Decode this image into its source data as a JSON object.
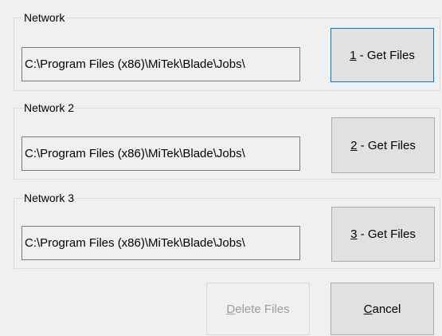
{
  "groups": [
    {
      "label": "Network",
      "path": "C:\\Program Files (x86)\\MiTek\\Blade\\Jobs\\",
      "button_mnemonic": "1",
      "button_rest": " - Get Files"
    },
    {
      "label": "Network 2",
      "path": "C:\\Program Files (x86)\\MiTek\\Blade\\Jobs\\",
      "button_mnemonic": "2",
      "button_rest": " - Get Files"
    },
    {
      "label": "Network 3",
      "path": "C:\\Program Files (x86)\\MiTek\\Blade\\Jobs\\",
      "button_mnemonic": "3",
      "button_rest": " - Get Files"
    }
  ],
  "footer": {
    "delete_mnemonic": "D",
    "delete_rest": "elete Files",
    "delete_enabled": false,
    "cancel_mnemonic": "C",
    "cancel_rest": "ancel"
  },
  "colors": {
    "background": "#f0f0f0",
    "focus_border": "#0078d7",
    "disabled_text": "#9d9d9d"
  }
}
